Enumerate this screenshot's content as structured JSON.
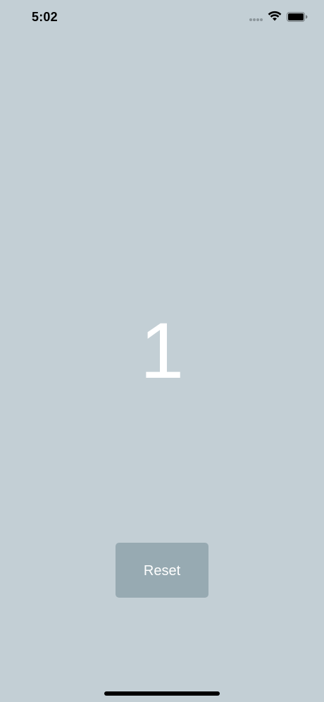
{
  "status_bar": {
    "time": "5:02",
    "signal_icon": "cellular-signal-icon",
    "wifi_icon": "wifi-icon",
    "battery_icon": "battery-icon"
  },
  "counter": {
    "value": "1"
  },
  "reset_button": {
    "label": "Reset"
  },
  "colors": {
    "background": "#c3cfd5",
    "button": "#97aab2",
    "text": "#ffffff"
  }
}
